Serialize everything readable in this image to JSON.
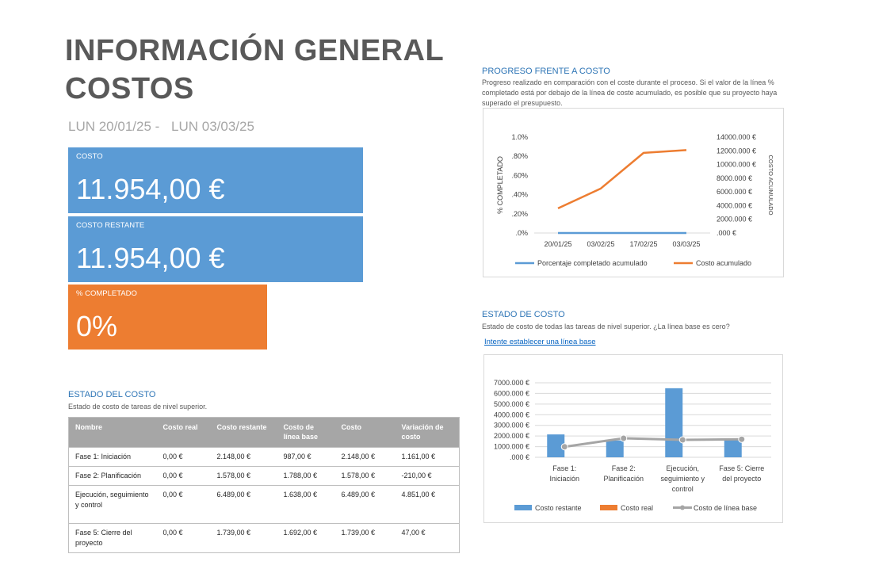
{
  "header": {
    "title_line1": "INFORMACIÓN GENERAL",
    "title_line2": "COSTOS",
    "date_start": "LUN 20/01/25 -",
    "date_end": "LUN 03/03/25"
  },
  "tiles": {
    "cost_label": "COSTO",
    "cost_value": "11.954,00 €",
    "remaining_label": "COSTO RESTANTE",
    "remaining_value": "11.954,00 €",
    "completed_label": "% COMPLETADO",
    "completed_value": "0%"
  },
  "colors": {
    "blue": "#5b9bd5",
    "orange": "#ed7d31",
    "gray": "#a5a5a5",
    "title_blue": "#2e75b6"
  },
  "cost_table": {
    "title": "ESTADO DEL COSTO",
    "subtitle": "Estado de costo de tareas de nivel superior.",
    "headers": [
      "Nombre",
      "Costo real",
      "Costo restante",
      "Costo de línea base",
      "Costo",
      "Variación de costo"
    ],
    "rows": [
      [
        "Fase 1: Iniciación",
        "0,00 €",
        "2.148,00 €",
        "987,00 €",
        "2.148,00 €",
        "1.161,00 €"
      ],
      [
        "Fase 2: Planificación",
        "0,00 €",
        "1.578,00 €",
        "1.788,00 €",
        "1.578,00 €",
        "-210,00 €"
      ],
      [
        "Ejecución, seguimiento y control",
        "0,00 €",
        "6.489,00 €",
        "1.638,00 €",
        "6.489,00 €",
        "4.851,00 €"
      ],
      [
        "Fase 5: Cierre del proyecto",
        "0,00 €",
        "1.739,00 €",
        "1.692,00 €",
        "1.739,00 €",
        "47,00 €"
      ]
    ]
  },
  "progress_section": {
    "title": "PROGRESO FRENTE A COSTO",
    "desc1": "Progreso realizado en comparación con el coste durante el proceso. Si el valor de la línea %",
    "desc2": "completado está por debajo de la línea de coste acumulado, es posible que su proyecto haya",
    "desc3": "superado el presupuesto."
  },
  "state_section": {
    "title": "ESTADO DE COSTO",
    "desc": "Estado de costo de todas las tareas de nivel superior. ¿La línea base es cero?",
    "link": "Intente establecer una línea base"
  },
  "chart_data": [
    {
      "type": "line",
      "x": [
        "20/01/25",
        "03/02/25",
        "17/02/25",
        "03/03/25"
      ],
      "y_left_label": "% COMPLETADO",
      "y_right_label": "COSTO ACUMULADO",
      "y_left_ticks": [
        "1.0%",
        ".80%",
        ".60%",
        ".40%",
        ".20%",
        ".0%"
      ],
      "y_right_ticks": [
        "14000.000 €",
        "12000.000 €",
        "10000.000 €",
        "8000.000 €",
        "6000.000 €",
        "4000.000 €",
        "2000.000 €",
        ".000 €"
      ],
      "ylim_left": [
        0,
        1.0
      ],
      "ylim_right": [
        0,
        14000
      ],
      "series": [
        {
          "name": "Porcentaje completado acumulado",
          "axis": "left",
          "color": "#5b9bd5",
          "values": [
            0,
            0,
            0,
            0
          ]
        },
        {
          "name": "Costo acumulado",
          "axis": "right",
          "color": "#ed7d31",
          "values": [
            3600,
            6500,
            11700,
            12100
          ]
        }
      ],
      "legend": "bottom"
    },
    {
      "type": "bar",
      "categories": [
        [
          "Fase 1:",
          "Iniciación"
        ],
        [
          "Fase 2:",
          "Planificación"
        ],
        [
          "Ejecución,",
          "seguimiento y",
          "control"
        ],
        [
          "Fase 5: Cierre",
          "del proyecto"
        ]
      ],
      "y_ticks": [
        "7000.000 €",
        "6000.000 €",
        "5000.000 €",
        "4000.000 €",
        "3000.000 €",
        "2000.000 €",
        "1000.000 €",
        ".000 €"
      ],
      "ylim": [
        0,
        7000
      ],
      "series": [
        {
          "name": "Costo restante",
          "type": "bar",
          "color": "#5b9bd5",
          "values": [
            2148,
            1578,
            6489,
            1739
          ]
        },
        {
          "name": "Costo real",
          "type": "bar",
          "color": "#ed7d31",
          "values": [
            0,
            0,
            0,
            0
          ]
        },
        {
          "name": "Costo de línea base",
          "type": "line",
          "color": "#a5a5a5",
          "values": [
            987,
            1788,
            1638,
            1692
          ]
        }
      ],
      "legend": "bottom"
    }
  ]
}
